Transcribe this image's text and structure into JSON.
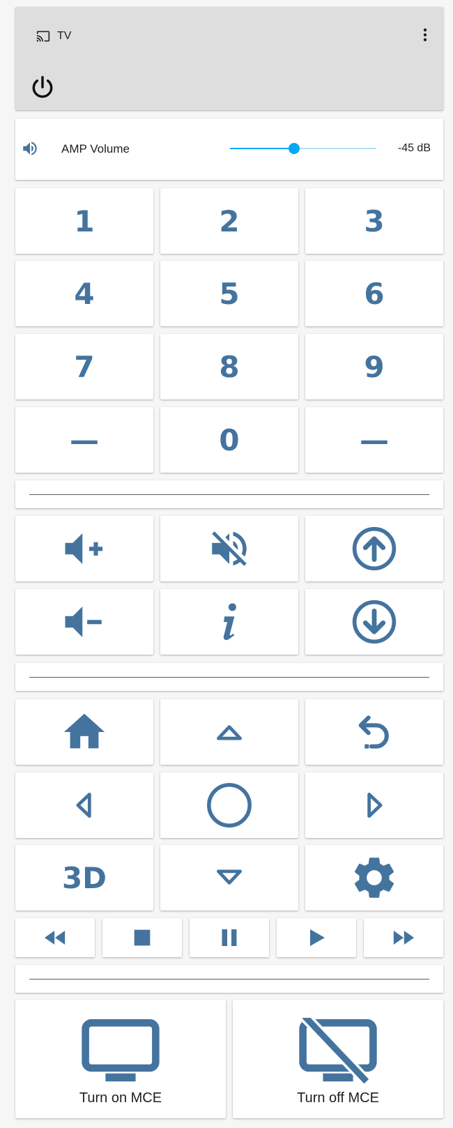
{
  "media": {
    "title": "TV",
    "icons": {
      "cast": "cast-icon",
      "menu": "more-vertical-icon",
      "power": "power-icon"
    }
  },
  "volume": {
    "label": "AMP Volume",
    "value_text": "-45 dB",
    "slider_fraction": 0.44,
    "icon": "speaker-icon"
  },
  "keypad": {
    "rows": [
      [
        "1",
        "2",
        "3"
      ],
      [
        "4",
        "5",
        "6"
      ],
      [
        "7",
        "8",
        "9"
      ],
      [
        "—",
        "0",
        "—"
      ]
    ]
  },
  "controls": {
    "icons": [
      "volume-plus-icon",
      "volume-mute-icon",
      "channel-up-icon",
      "volume-minus-icon",
      "info-icon",
      "channel-down-icon"
    ]
  },
  "navigation": {
    "icons": [
      "home-icon",
      "up-icon",
      "back-icon",
      "left-icon",
      "ok-icon",
      "right-icon",
      "3d-icon",
      "down-icon",
      "settings-icon"
    ],
    "label_3d": "3D"
  },
  "transport": {
    "icons": [
      "rewind-icon",
      "stop-icon",
      "pause-icon",
      "play-icon",
      "fast-forward-icon"
    ]
  },
  "mce": {
    "on_label": "Turn on MCE",
    "off_label": "Turn off MCE"
  },
  "colors": {
    "icon": "#44739e",
    "accent": "#03a9f4",
    "media_bg": "#dedede",
    "page_bg": "#f6f6f6"
  }
}
